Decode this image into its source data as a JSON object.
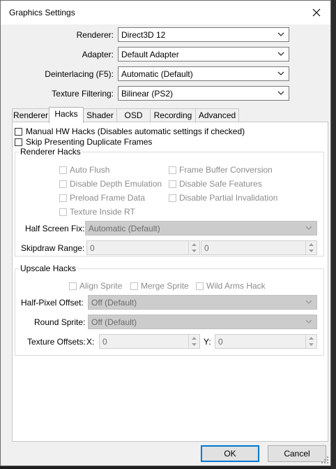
{
  "window": {
    "title": "Graphics Settings"
  },
  "top_settings": {
    "renderer": {
      "label": "Renderer:",
      "value": "Direct3D 12"
    },
    "adapter": {
      "label": "Adapter:",
      "value": "Default Adapter"
    },
    "deinterlacing": {
      "label": "Deinterlacing (F5):",
      "value": "Automatic (Default)"
    },
    "texture_filtering": {
      "label": "Texture Filtering:",
      "value": "Bilinear (PS2)"
    }
  },
  "tabs": [
    "Renderer",
    "Hacks",
    "Shader",
    "OSD",
    "Recording",
    "Advanced"
  ],
  "active_tab": "Hacks",
  "hacks": {
    "manual_hw_hacks": {
      "label": "Manual HW Hacks (Disables automatic settings if checked)",
      "checked": false
    },
    "skip_duplicate_frames": {
      "label": "Skip Presenting Duplicate Frames",
      "checked": false
    },
    "renderer_hacks": {
      "title": "Renderer Hacks",
      "checkboxes": [
        "Auto Flush",
        "Frame Buffer Conversion",
        "Disable Depth Emulation",
        "Disable Safe Features",
        "Preload Frame Data",
        "Disable Partial Invalidation",
        "Texture Inside RT"
      ],
      "half_screen_fix": {
        "label": "Half Screen Fix:",
        "value": "Automatic (Default)"
      },
      "skipdraw_range": {
        "label": "Skipdraw Range:",
        "start": "0",
        "end": "0"
      }
    },
    "upscale_hacks": {
      "title": "Upscale Hacks",
      "checkboxes": [
        "Align Sprite",
        "Merge Sprite",
        "Wild Arms Hack"
      ],
      "half_pixel_offset": {
        "label": "Half-Pixel Offset:",
        "value": "Off (Default)"
      },
      "round_sprite": {
        "label": "Round Sprite:",
        "value": "Off (Default)"
      },
      "texture_offsets": {
        "label": "Texture Offsets:",
        "x_label": "X:",
        "x_value": "0",
        "y_label": "Y:",
        "y_value": "0"
      }
    }
  },
  "buttons": {
    "ok": "OK",
    "cancel": "Cancel"
  }
}
